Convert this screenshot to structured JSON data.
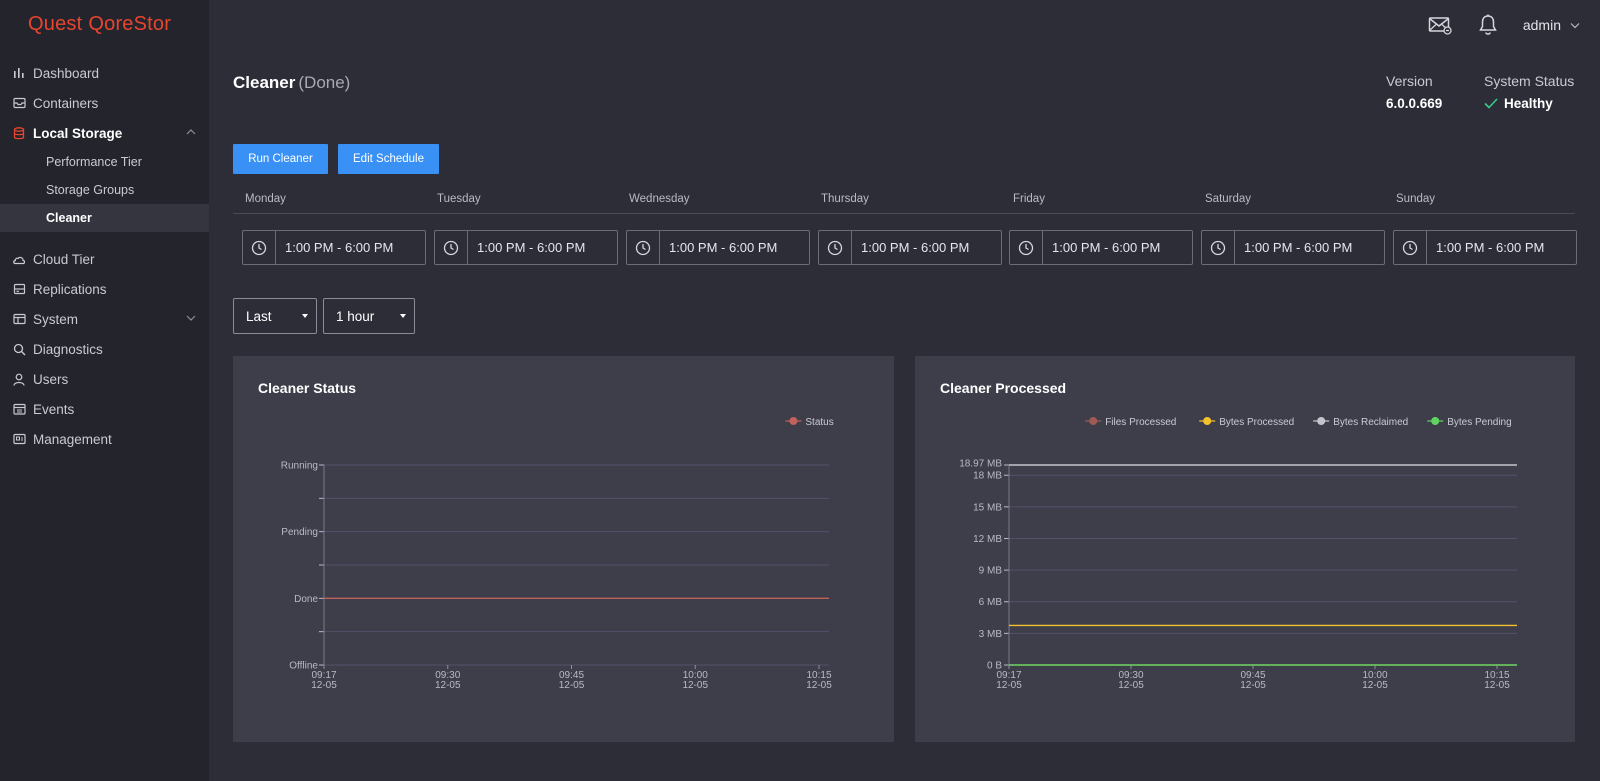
{
  "app": {
    "logo_word1": "Quest",
    "logo_word2": "QoreStor"
  },
  "sidebar": {
    "items": [
      {
        "label": "Dashboard",
        "icon": "bar-chart-icon"
      },
      {
        "label": "Containers",
        "icon": "inbox-icon"
      },
      {
        "label": "Local Storage",
        "icon": "database-icon",
        "active": true,
        "expanded": true,
        "children": [
          {
            "label": "Performance Tier"
          },
          {
            "label": "Storage Groups"
          },
          {
            "label": "Cleaner",
            "selected": true
          }
        ]
      },
      {
        "label": "Cloud Tier",
        "icon": "cloud-icon"
      },
      {
        "label": "Replications",
        "icon": "drive-icon"
      },
      {
        "label": "System",
        "icon": "window-icon",
        "expandable": true
      },
      {
        "label": "Diagnostics",
        "icon": "search-icon"
      },
      {
        "label": "Users",
        "icon": "user-icon"
      },
      {
        "label": "Events",
        "icon": "calendar-icon"
      },
      {
        "label": "Management",
        "icon": "management-icon"
      }
    ]
  },
  "topbar": {
    "user": "admin",
    "mail_icon": "mail-icon",
    "bell_icon": "bell-icon"
  },
  "header": {
    "title": "Cleaner",
    "status": "(Done)",
    "version_label": "Version",
    "version_value": "6.0.0.669",
    "system_status_label": "System Status",
    "system_status_value": "Healthy",
    "healthy_color": "#3cc98a"
  },
  "buttons": {
    "run": "Run Cleaner",
    "edit": "Edit Schedule",
    "color": "#3a91f5"
  },
  "schedule": {
    "days": [
      "Monday",
      "Tuesday",
      "Wednesday",
      "Thursday",
      "Friday",
      "Saturday",
      "Sunday"
    ],
    "times": [
      "1:00 PM - 6:00 PM",
      "1:00 PM - 6:00 PM",
      "1:00 PM - 6:00 PM",
      "1:00 PM - 6:00 PM",
      "1:00 PM - 6:00 PM",
      "1:00 PM - 6:00 PM",
      "1:00 PM - 6:00 PM"
    ]
  },
  "filters": {
    "range_mode": "Last",
    "range_value": "1 hour"
  },
  "charts": {
    "status_title": "Cleaner Status",
    "processed_title": "Cleaner Processed"
  },
  "chart_data": [
    {
      "type": "line",
      "title": "Cleaner Status",
      "x": [
        "09:17\n12-05",
        "09:30\n12-05",
        "09:45\n12-05",
        "10:00\n12-05",
        "10:15\n12-05"
      ],
      "y_categories": [
        "Offline",
        "Done",
        "Pending",
        "Running"
      ],
      "series": [
        {
          "name": "Status",
          "color": "#c0615b",
          "values": [
            "Done",
            "Done",
            "Done",
            "Done",
            "Done"
          ]
        }
      ],
      "legend": "top-right",
      "grid": true
    },
    {
      "type": "line",
      "title": "Cleaner Processed",
      "x": [
        "09:17\n12-05",
        "09:30\n12-05",
        "09:45\n12-05",
        "10:00\n12-05",
        "10:15\n12-05"
      ],
      "y_ticks": [
        "0  B",
        "3 MB",
        "6 MB",
        "9 MB",
        "12 MB",
        "15 MB",
        "18 MB",
        "18.97 MB"
      ],
      "ylim": [
        0,
        18.97
      ],
      "y_unit": "MB",
      "series": [
        {
          "name": "Files Processed",
          "color": "#a05a56",
          "values": [
            0,
            0,
            0,
            0,
            0
          ]
        },
        {
          "name": "Bytes Processed",
          "color": "#f2c12e",
          "values": [
            3.75,
            3.75,
            3.75,
            3.75,
            3.75
          ]
        },
        {
          "name": "Bytes Reclaimed",
          "color": "#c4c5cc",
          "values": [
            18.97,
            18.97,
            18.97,
            18.97,
            18.97
          ]
        },
        {
          "name": "Bytes Pending",
          "color": "#5fd35f",
          "values": [
            0,
            0,
            0,
            0,
            0
          ]
        }
      ],
      "legend": "top-right",
      "grid": true
    }
  ]
}
